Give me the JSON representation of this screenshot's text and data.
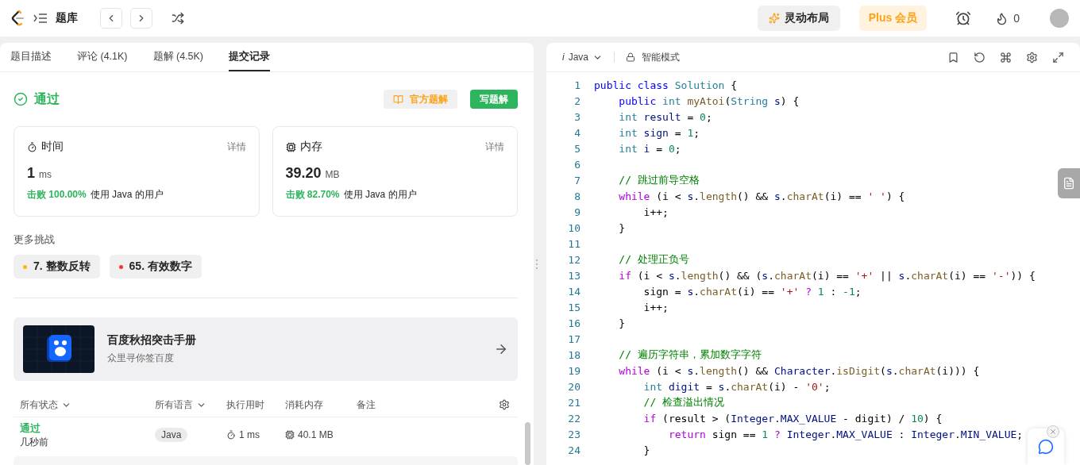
{
  "top_bar": {
    "title": "题库",
    "layout_button": "灵动布局",
    "plus_button": "Plus 会员",
    "streak": "0"
  },
  "tabs": [
    {
      "label": "题目描述",
      "selected": false
    },
    {
      "label": "评论 (4.1K)",
      "selected": false
    },
    {
      "label": "题解 (4.5K)",
      "selected": false
    },
    {
      "label": "提交记录",
      "selected": true
    }
  ],
  "result": {
    "status": "通过",
    "official_button": "官方题解",
    "write_button": "写题解"
  },
  "stats": [
    {
      "kind": "time",
      "label": "时间",
      "detail": "详情",
      "value": "1",
      "unit": "ms",
      "beats": "击败 100.00%",
      "beats_note": "使用 Java 的用户"
    },
    {
      "kind": "memory",
      "label": "内存",
      "detail": "详情",
      "value": "39.20",
      "unit": "MB",
      "beats": "击败 82.70%",
      "beats_note": "使用 Java 的用户"
    }
  ],
  "more_title": "更多挑战",
  "challenges": [
    {
      "label": "7. 整数反转",
      "color": "#ffb800"
    },
    {
      "label": "65. 有效数字",
      "color": "#f63636"
    }
  ],
  "banner": {
    "kind": "picture",
    "title": "百度秋招突击手册",
    "subtitle": "众里寻你签百度"
  },
  "table": {
    "columns": [
      {
        "label": "所有状态",
        "dropdown": true
      },
      {
        "label": "所有语言",
        "dropdown": true
      },
      {
        "label": "执行用时",
        "dropdown": false
      },
      {
        "label": "消耗内存",
        "dropdown": false
      },
      {
        "label": "备注",
        "dropdown": false
      }
    ],
    "rows": [
      {
        "status": "通过",
        "time_ago": "几秒前",
        "language": "Java",
        "runtime": "1 ms",
        "memory": "40.1 MB"
      }
    ]
  },
  "editor": {
    "language_icon": "i",
    "language": "Java",
    "mode": "智能模式",
    "lines": [
      {
        "number": "1",
        "tokens": [
          {
            "kind": "kw",
            "text": "public"
          },
          {
            "kind": "kw",
            "text": " class"
          },
          {
            "kind": "type",
            "text": " Solution"
          },
          {
            "kind": "p",
            "text": " {"
          }
        ]
      },
      {
        "number": "2",
        "tokens": [
          {
            "kind": "kw",
            "text": "    public"
          },
          {
            "kind": "type",
            "text": " int"
          },
          {
            "kind": "fn",
            "text": " myAtoi"
          },
          {
            "kind": "p",
            "text": "("
          },
          {
            "kind": "type",
            "text": "String"
          },
          {
            "kind": "var",
            "text": " s"
          },
          {
            "kind": "p",
            "text": ") {"
          }
        ]
      },
      {
        "number": "3",
        "tokens": [
          {
            "kind": "type",
            "text": "    int"
          },
          {
            "kind": "var",
            "text": " result"
          },
          {
            "kind": "p",
            "text": " = "
          },
          {
            "kind": "num",
            "text": "0"
          },
          {
            "kind": "p",
            "text": ";"
          }
        ]
      },
      {
        "number": "4",
        "tokens": [
          {
            "kind": "type",
            "text": "    int"
          },
          {
            "kind": "var",
            "text": " sign"
          },
          {
            "kind": "p",
            "text": " = "
          },
          {
            "kind": "num",
            "text": "1"
          },
          {
            "kind": "p",
            "text": ";"
          }
        ]
      },
      {
        "number": "5",
        "tokens": [
          {
            "kind": "type",
            "text": "    int"
          },
          {
            "kind": "var",
            "text": " i"
          },
          {
            "kind": "p",
            "text": " = "
          },
          {
            "kind": "num",
            "text": "0"
          },
          {
            "kind": "p",
            "text": ";"
          }
        ]
      },
      {
        "number": "6"
      },
      {
        "number": "7",
        "tokens": [
          {
            "kind": "cmt",
            "text": "    // 跳过前导空格"
          }
        ]
      },
      {
        "number": "8",
        "tokens": [
          {
            "kind": "ctl",
            "text": "    while"
          },
          {
            "kind": "p",
            "text": " (i < "
          },
          {
            "kind": "var",
            "text": "s"
          },
          {
            "kind": "p",
            "text": "."
          },
          {
            "kind": "fn",
            "text": "length"
          },
          {
            "kind": "p",
            "text": "() && "
          },
          {
            "kind": "var",
            "text": "s"
          },
          {
            "kind": "p",
            "text": "."
          },
          {
            "kind": "fn",
            "text": "charAt"
          },
          {
            "kind": "p",
            "text": "(i) == "
          },
          {
            "kind": "str",
            "text": "' '"
          },
          {
            "kind": "p",
            "text": ") {"
          }
        ]
      },
      {
        "number": "9",
        "tokens": [
          {
            "kind": "p",
            "text": "        i++;"
          }
        ]
      },
      {
        "number": "10",
        "tokens": [
          {
            "kind": "p",
            "text": "    }"
          }
        ]
      },
      {
        "number": "11"
      },
      {
        "number": "12",
        "tokens": [
          {
            "kind": "cmt",
            "text": "    // 处理正负号"
          }
        ]
      },
      {
        "number": "13",
        "tokens": [
          {
            "kind": "ctl",
            "text": "    if"
          },
          {
            "kind": "p",
            "text": " (i < "
          },
          {
            "kind": "var",
            "text": "s"
          },
          {
            "kind": "p",
            "text": "."
          },
          {
            "kind": "fn",
            "text": "length"
          },
          {
            "kind": "p",
            "text": "() && ("
          },
          {
            "kind": "var",
            "text": "s"
          },
          {
            "kind": "p",
            "text": "."
          },
          {
            "kind": "fn",
            "text": "charAt"
          },
          {
            "kind": "p",
            "text": "(i) == "
          },
          {
            "kind": "str",
            "text": "'+'"
          },
          {
            "kind": "p",
            "text": " || "
          },
          {
            "kind": "var",
            "text": "s"
          },
          {
            "kind": "p",
            "text": "."
          },
          {
            "kind": "fn",
            "text": "charAt"
          },
          {
            "kind": "p",
            "text": "(i) == "
          },
          {
            "kind": "str",
            "text": "'-'"
          },
          {
            "kind": "p",
            "text": ")) {"
          }
        ]
      },
      {
        "number": "14",
        "tokens": [
          {
            "kind": "p",
            "text": "        sign = "
          },
          {
            "kind": "var",
            "text": "s"
          },
          {
            "kind": "p",
            "text": "."
          },
          {
            "kind": "fn",
            "text": "charAt"
          },
          {
            "kind": "p",
            "text": "(i) == "
          },
          {
            "kind": "str",
            "text": "'+'"
          },
          {
            "kind": "ctl",
            "text": " ?"
          },
          {
            "kind": "num",
            "text": " 1"
          },
          {
            "kind": "p",
            "text": " : "
          },
          {
            "kind": "num",
            "text": "-1"
          },
          {
            "kind": "p",
            "text": ";"
          }
        ]
      },
      {
        "number": "15",
        "tokens": [
          {
            "kind": "p",
            "text": "        i++;"
          }
        ]
      },
      {
        "number": "16",
        "tokens": [
          {
            "kind": "p",
            "text": "    }"
          }
        ]
      },
      {
        "number": "17"
      },
      {
        "number": "18",
        "tokens": [
          {
            "kind": "cmt",
            "text": "    // 遍历字符串，累加数字字符"
          }
        ]
      },
      {
        "number": "19",
        "tokens": [
          {
            "kind": "ctl",
            "text": "    while"
          },
          {
            "kind": "p",
            "text": " (i < "
          },
          {
            "kind": "var",
            "text": "s"
          },
          {
            "kind": "p",
            "text": "."
          },
          {
            "kind": "fn",
            "text": "length"
          },
          {
            "kind": "p",
            "text": "() && "
          },
          {
            "kind": "var",
            "text": "Character"
          },
          {
            "kind": "p",
            "text": "."
          },
          {
            "kind": "fn",
            "text": "isDigit"
          },
          {
            "kind": "p",
            "text": "("
          },
          {
            "kind": "var",
            "text": "s"
          },
          {
            "kind": "p",
            "text": "."
          },
          {
            "kind": "fn",
            "text": "charAt"
          },
          {
            "kind": "p",
            "text": "(i))) {"
          }
        ]
      },
      {
        "number": "20",
        "tokens": [
          {
            "kind": "type",
            "text": "        int"
          },
          {
            "kind": "var",
            "text": " digit"
          },
          {
            "kind": "p",
            "text": " = "
          },
          {
            "kind": "var",
            "text": "s"
          },
          {
            "kind": "p",
            "text": "."
          },
          {
            "kind": "fn",
            "text": "charAt"
          },
          {
            "kind": "p",
            "text": "(i) - "
          },
          {
            "kind": "str",
            "text": "'0'"
          },
          {
            "kind": "p",
            "text": ";"
          }
        ]
      },
      {
        "number": "21",
        "tokens": [
          {
            "kind": "cmt",
            "text": "        // 检查溢出情况"
          }
        ]
      },
      {
        "number": "22",
        "tokens": [
          {
            "kind": "ctl",
            "text": "        if"
          },
          {
            "kind": "p",
            "text": " (result > ("
          },
          {
            "kind": "var",
            "text": "Integer"
          },
          {
            "kind": "p",
            "text": "."
          },
          {
            "kind": "var",
            "text": "MAX_VALUE"
          },
          {
            "kind": "p",
            "text": " - digit) / "
          },
          {
            "kind": "num",
            "text": "10"
          },
          {
            "kind": "p",
            "text": ") {"
          }
        ]
      },
      {
        "number": "23",
        "tokens": [
          {
            "kind": "ctl",
            "text": "            return"
          },
          {
            "kind": "p",
            "text": " sign == "
          },
          {
            "kind": "num",
            "text": "1"
          },
          {
            "kind": "ctl",
            "text": " ?"
          },
          {
            "kind": "var",
            "text": " Integer"
          },
          {
            "kind": "p",
            "text": "."
          },
          {
            "kind": "var",
            "text": "MAX_VALUE"
          },
          {
            "kind": "p",
            "text": " : "
          },
          {
            "kind": "var",
            "text": "Integer"
          },
          {
            "kind": "p",
            "text": "."
          },
          {
            "kind": "var",
            "text": "MIN_VALUE"
          },
          {
            "kind": "p",
            "text": ";"
          }
        ]
      },
      {
        "number": "24",
        "tokens": [
          {
            "kind": "p",
            "text": "        }"
          }
        ]
      }
    ]
  }
}
